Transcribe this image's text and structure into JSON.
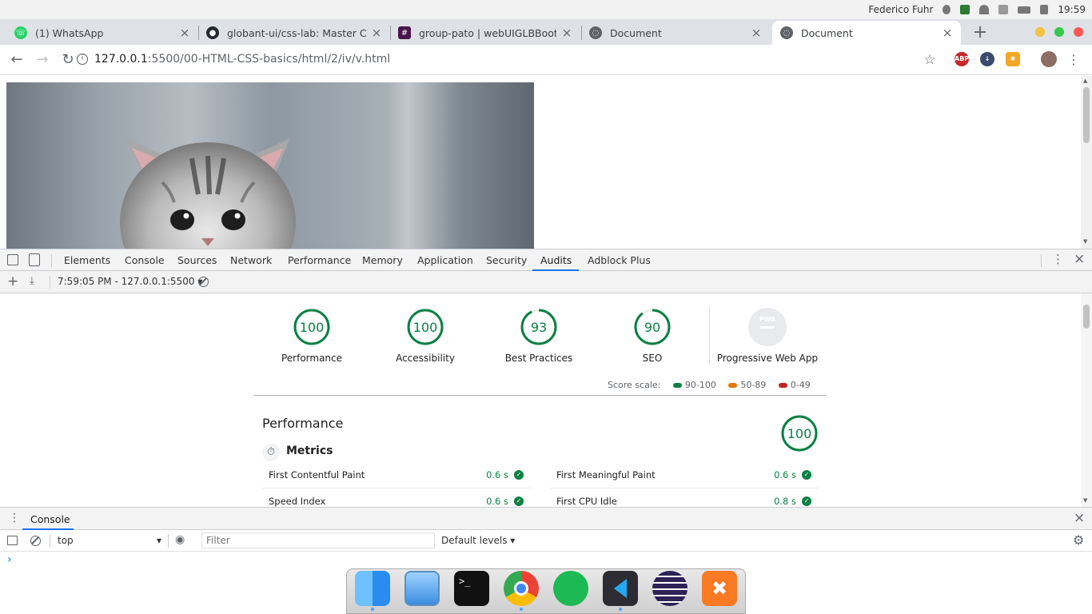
{
  "system_bar": {
    "user": "Federico Fuhr",
    "time": "19:59"
  },
  "tabs": [
    {
      "title": "(1) WhatsApp",
      "icon": "whatsapp-icon"
    },
    {
      "title": "globant-ui/css-lab: Master CSS",
      "icon": "github-icon"
    },
    {
      "title": "group-pato | webUIGLBBootca",
      "icon": "slack-icon"
    },
    {
      "title": "Document",
      "icon": "globe-icon"
    },
    {
      "title": "Document",
      "icon": "globe-icon",
      "active": true
    }
  ],
  "toolbar": {
    "url_host": "127.0.0.1",
    "url_path": ":5500/00-HTML-CSS-basics/html/2/iv/v.html"
  },
  "extensions": {
    "adblock": "ABP"
  },
  "devtools": {
    "tabs": [
      "Elements",
      "Console",
      "Sources",
      "Network",
      "Performance",
      "Memory",
      "Application",
      "Security",
      "Audits",
      "Adblock Plus"
    ],
    "active_tab": "Audits",
    "report_selector": "7:59:05 PM - 127.0.0.1:5500"
  },
  "audits": {
    "gauges": [
      {
        "label": "Performance",
        "score": 100
      },
      {
        "label": "Accessibility",
        "score": 100
      },
      {
        "label": "Best Practices",
        "score": 93
      },
      {
        "label": "SEO",
        "score": 90
      }
    ],
    "pwa_label": "Progressive Web App",
    "pwa_badge": "PWA",
    "score_scale": {
      "label": "Score scale:",
      "ranges": [
        {
          "label": "90-100",
          "color": "#0b8043"
        },
        {
          "label": "50-89",
          "color": "#e67700"
        },
        {
          "label": "0-49",
          "color": "#c5221f"
        }
      ]
    },
    "performance": {
      "title": "Performance",
      "score": 100,
      "metrics_title": "Metrics",
      "metrics": [
        {
          "name": "First Contentful Paint",
          "value": "0.6 s"
        },
        {
          "name": "First Meaningful Paint",
          "value": "0.6 s"
        },
        {
          "name": "Speed Index",
          "value": "0.6 s"
        },
        {
          "name": "First CPU Idle",
          "value": "0.8 s"
        }
      ]
    }
  },
  "console": {
    "tab": "Console",
    "context": "top",
    "filter_placeholder": "Filter",
    "levels": "Default levels",
    "prompt": "›"
  },
  "colors": {
    "pass": "#0b8043",
    "accent": "#1a73e8"
  },
  "dock": [
    "finder-icon",
    "files-icon",
    "terminal-icon",
    "chrome-icon",
    "spotify-icon",
    "vscode-icon",
    "eclipse-icon",
    "xampp-icon"
  ]
}
